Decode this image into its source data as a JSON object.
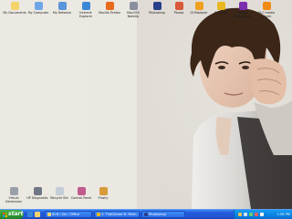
{
  "desktop": {
    "icons_top": [
      {
        "label": "My Documents",
        "icon": "folder-icon",
        "color": "#f5d36b"
      },
      {
        "label": "My Computer",
        "icon": "computer-icon",
        "color": "#6ea6e8"
      },
      {
        "label": "My Network",
        "icon": "network-icon",
        "color": "#5b95db"
      },
      {
        "label": "Internet Explorer",
        "icon": "globe-icon",
        "color": "#3a86d6"
      },
      {
        "label": "Mozilla Firefox",
        "icon": "firefox-icon",
        "color": "#e86a1c"
      },
      {
        "label": "MacOSX NoteUp",
        "icon": "app-icon",
        "color": "#8a8fa0"
      },
      {
        "label": "Photoshop",
        "icon": "photoshop-icon",
        "color": "#2a3f8a"
      },
      {
        "label": "Picasa",
        "icon": "picasa-icon",
        "color": "#d8583a"
      },
      {
        "label": "GOMplayer",
        "icon": "gomplayer-icon",
        "color": "#f0a020"
      },
      {
        "label": "Winamp",
        "icon": "winamp-icon",
        "color": "#e9b820"
      },
      {
        "label": "Yahoo! Messenger",
        "icon": "messenger-icon",
        "color": "#7b2fb0"
      },
      {
        "label": "VLC media player",
        "icon": "vlc-icon",
        "color": "#f08a14"
      }
    ],
    "icons_bottom": [
      {
        "label": "Virtual Dimension",
        "icon": "printer-icon",
        "color": "#9aa0aa"
      },
      {
        "label": "HP Diagnostic",
        "icon": "printer-icon",
        "color": "#707784"
      },
      {
        "label": "Recycle Bin",
        "icon": "recycle-bin-icon",
        "color": "#c4ccd6"
      },
      {
        "label": "Control Panel",
        "icon": "control-panel-icon",
        "color": "#c25a8c"
      },
      {
        "label": "Flashy",
        "icon": "flash-icon",
        "color": "#d99a3a"
      }
    ]
  },
  "taskbar": {
    "start_label": "start",
    "tasks": [
      {
        "label": "AI-B / Jim / Office",
        "icon": "folder-icon",
        "color": "#f5d36b"
      },
      {
        "label": "1. TheDream ft. Rhet...",
        "icon": "winamp-icon",
        "color": "#e9b820"
      },
      {
        "label": "Photoshop",
        "icon": "photoshop-icon",
        "color": "#2a3f8a"
      }
    ],
    "clock": "1:56 PM"
  },
  "colors": {
    "taskbar": "#2459d8",
    "start": "#2f9a35",
    "tray": "#0b80e2"
  }
}
